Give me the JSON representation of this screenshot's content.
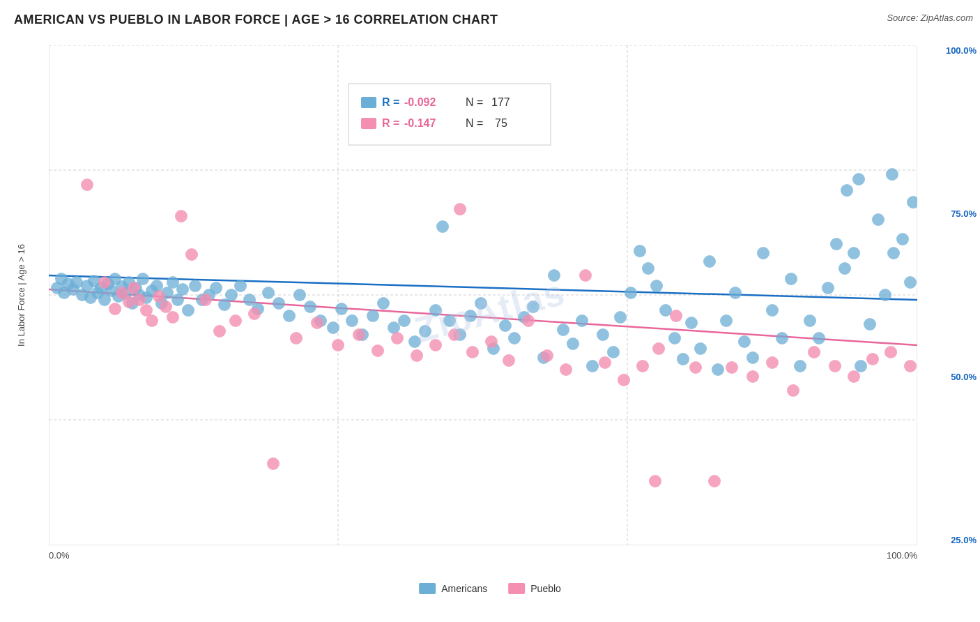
{
  "title": "AMERICAN VS PUEBLO IN LABOR FORCE | AGE > 16 CORRELATION CHART",
  "source": "Source: ZipAtlas.com",
  "yAxisLabel": "In Labor Force | Age > 16",
  "legend": {
    "items": [
      {
        "label": "Americans",
        "color": "#6baed6"
      },
      {
        "label": "Pueblo",
        "color": "#f48fb1"
      }
    ]
  },
  "legend_box_labels": {
    "americans": "Americans",
    "pueblo": "Pueblo"
  },
  "regression": {
    "blue": {
      "r": "-0.092",
      "n": "177",
      "color": "#1a6fc4"
    },
    "pink": {
      "r": "-0.147",
      "n": "75",
      "color": "#e85d8a"
    }
  },
  "yRight": {
    "labels": [
      "100.0%",
      "75.0%",
      "50.0%",
      "25.0%"
    ]
  },
  "xAxis": {
    "start": "0.0%",
    "end": "100.0%"
  },
  "watermark": "ZipAtlas",
  "colors": {
    "blue": "#6baed6",
    "pink": "#f48fb1",
    "blue_line": "#1a6fc4",
    "pink_line": "#e8679a",
    "blue_right": "#1565c0",
    "pink_right": "#c62828",
    "grid": "#e0e0e0"
  }
}
